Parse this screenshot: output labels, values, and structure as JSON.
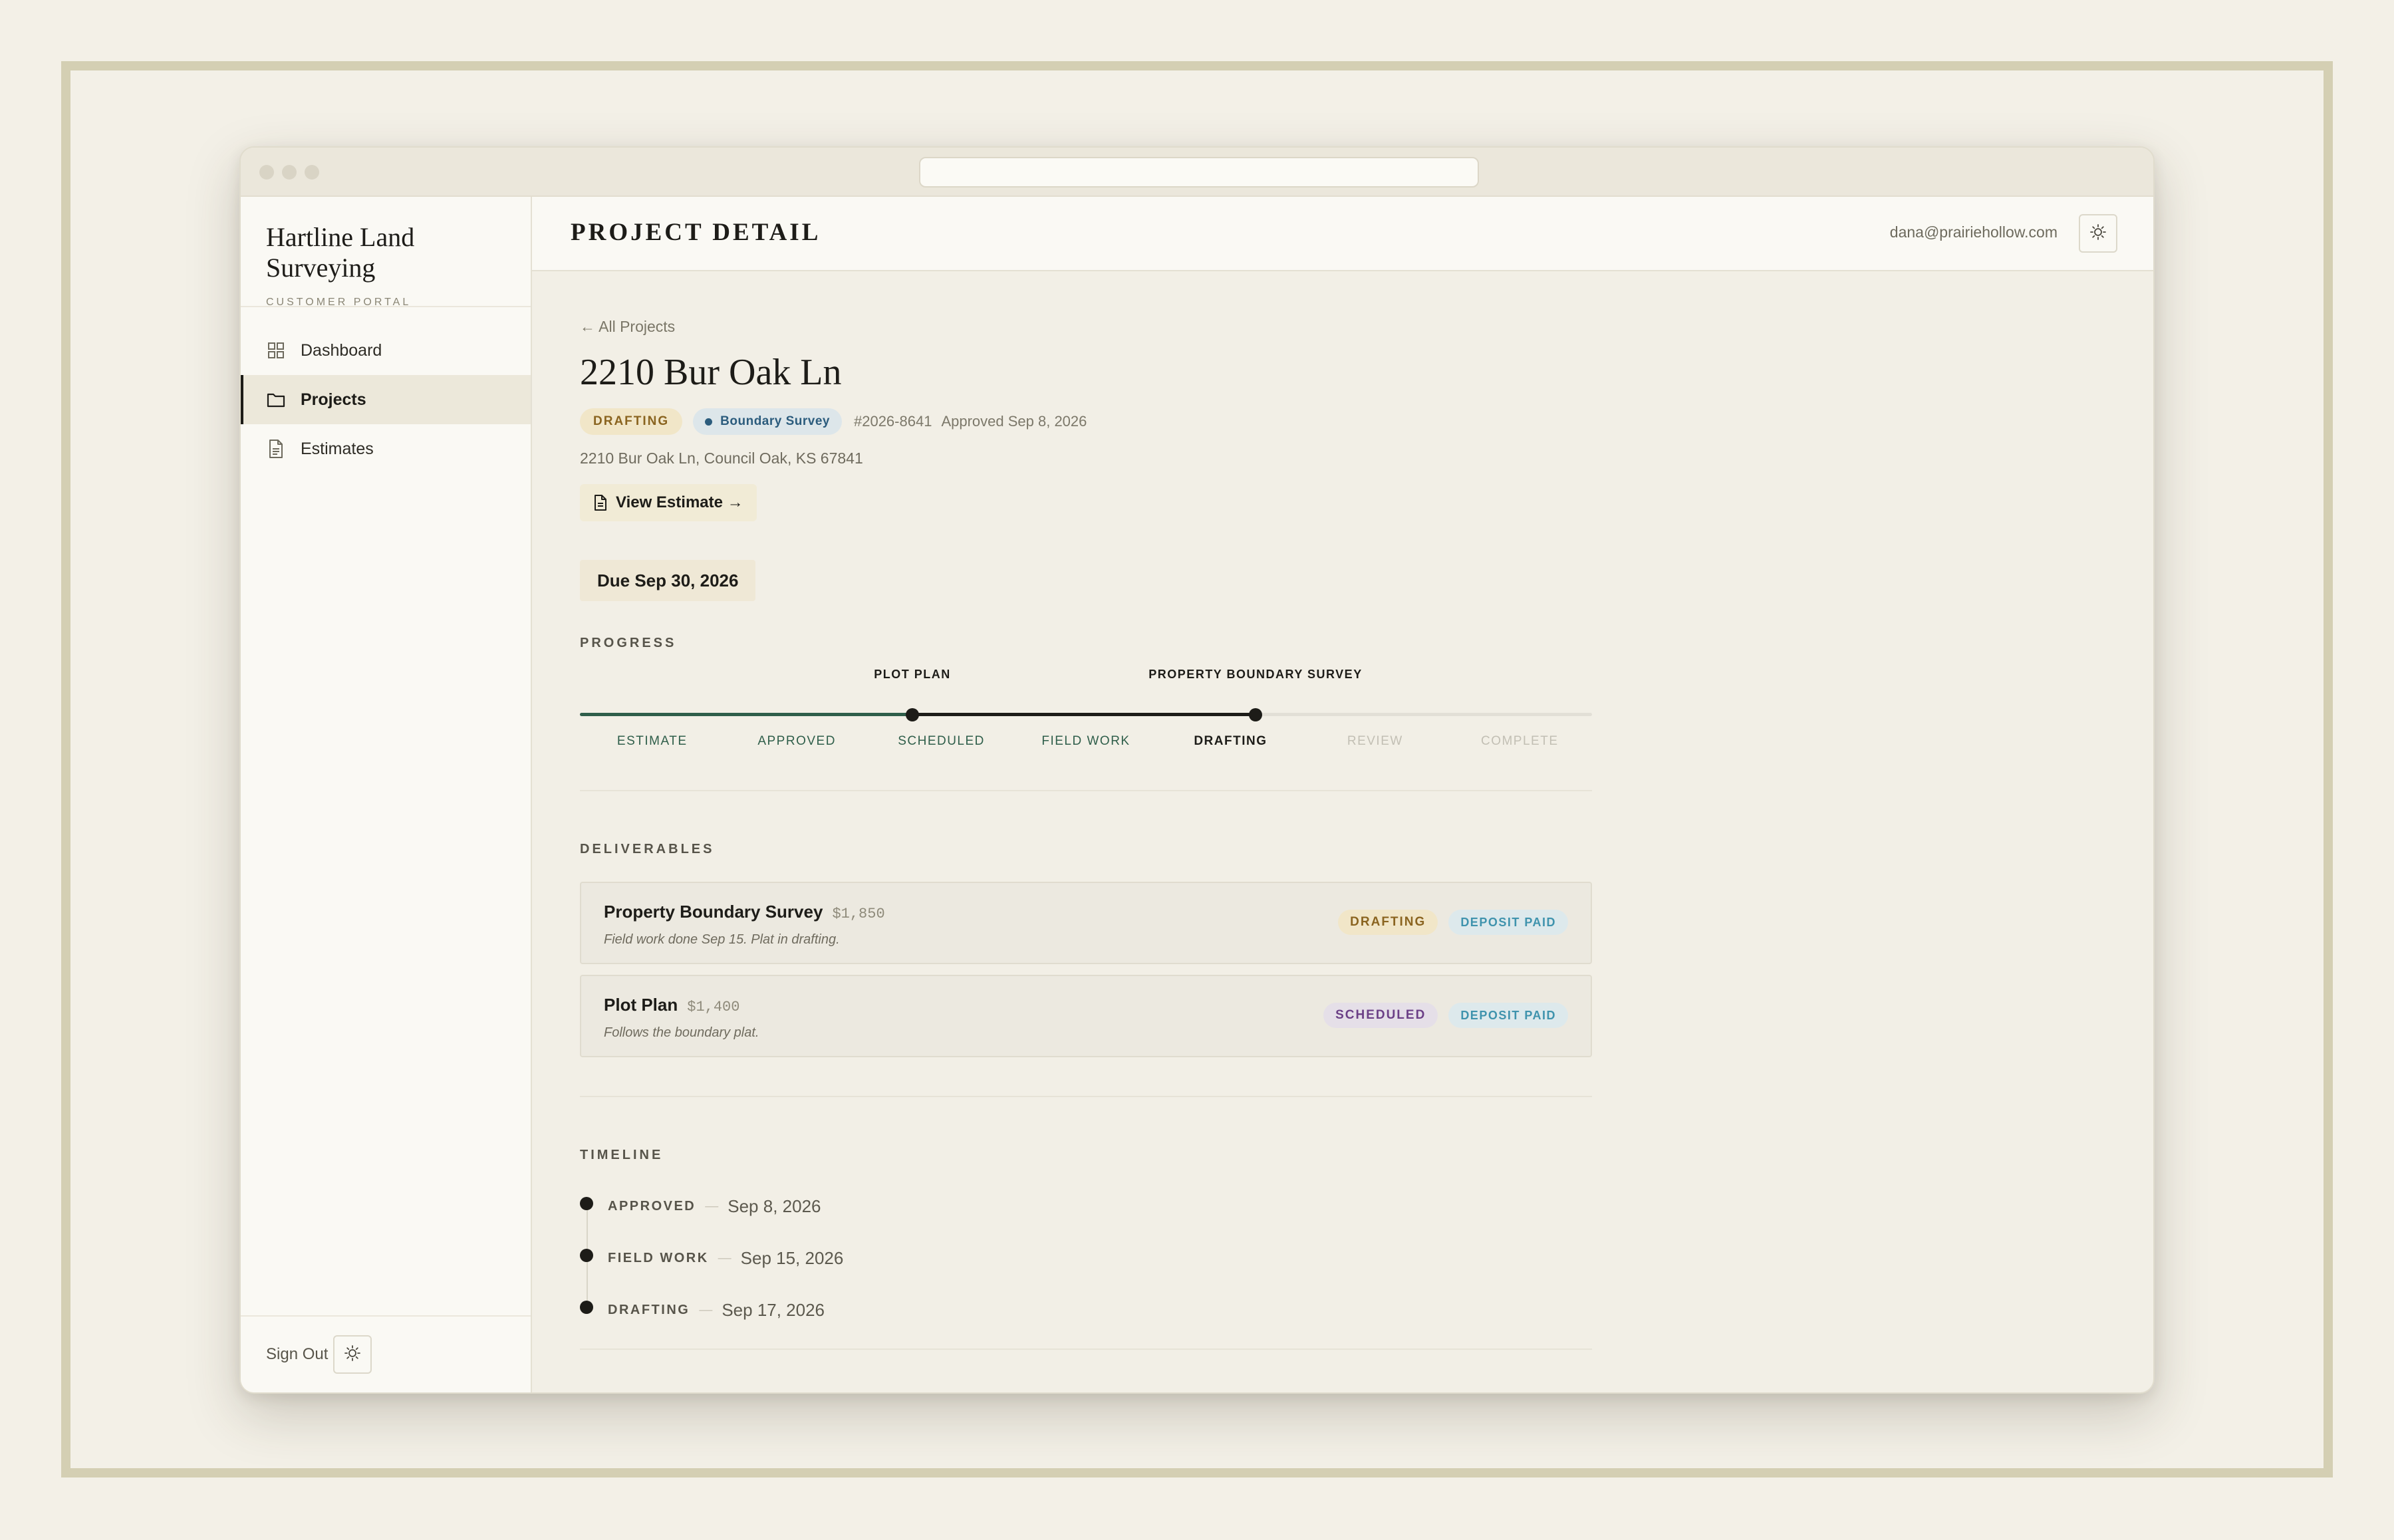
{
  "brand": {
    "name": "Hartline Land Surveying",
    "subtitle": "CUSTOMER PORTAL"
  },
  "sidebar": {
    "items": [
      {
        "label": "Dashboard",
        "icon": "grid-icon",
        "active": false
      },
      {
        "label": "Projects",
        "icon": "folder-icon",
        "active": true
      },
      {
        "label": "Estimates",
        "icon": "document-icon",
        "active": false
      }
    ],
    "sign_out": "Sign Out"
  },
  "header": {
    "title": "PROJECT DETAIL",
    "user_email": "dana@prairiehollow.com",
    "theme_icon": "sun-icon"
  },
  "project": {
    "back_link": "← All Projects",
    "title": "2210 Bur Oak Ln",
    "status": "DRAFTING",
    "type": "Boundary Survey",
    "number": "#2026-8641",
    "approved": "Approved Sep 8, 2026",
    "address": "2210 Bur Oak Ln, Council Oak, KS 67841",
    "estimate_button": "View Estimate →",
    "due": "Due Sep 30, 2026"
  },
  "progress": {
    "label": "PROGRESS",
    "stages": [
      {
        "name": "ESTIMATE",
        "state": "done"
      },
      {
        "name": "APPROVED",
        "state": "done"
      },
      {
        "name": "SCHEDULED",
        "state": "done"
      },
      {
        "name": "FIELD WORK",
        "state": "done"
      },
      {
        "name": "DRAFTING",
        "state": "current"
      },
      {
        "name": "REVIEW",
        "state": "future"
      },
      {
        "name": "COMPLETE",
        "state": "future"
      }
    ],
    "milestones": [
      {
        "label": "PLOT PLAN"
      },
      {
        "label": "PROPERTY BOUNDARY SURVEY"
      }
    ]
  },
  "deliverables": {
    "label": "DELIVERABLES",
    "items": [
      {
        "name": "Property Boundary Survey",
        "price": "$1,850",
        "note": "Field work done Sep 15. Plat in drafting.",
        "status": "DRAFTING",
        "payment": "DEPOSIT PAID"
      },
      {
        "name": "Plot Plan",
        "price": "$1,400",
        "note": "Follows the boundary plat.",
        "status": "SCHEDULED",
        "payment": "DEPOSIT PAID"
      }
    ]
  },
  "timeline": {
    "label": "TIMELINE",
    "items": [
      {
        "label": "APPROVED",
        "sep": "—",
        "date": "Sep 8, 2026"
      },
      {
        "label": "FIELD WORK",
        "sep": "—",
        "date": "Sep 15, 2026"
      },
      {
        "label": "DRAFTING",
        "sep": "—",
        "date": "Sep 17, 2026"
      }
    ]
  },
  "colors": {
    "accent_green": "#2f5e4a",
    "ink": "#1d1c18",
    "drafting": "#8a6420",
    "scheduled": "#6b3f86",
    "deposit": "#3f93ad"
  }
}
